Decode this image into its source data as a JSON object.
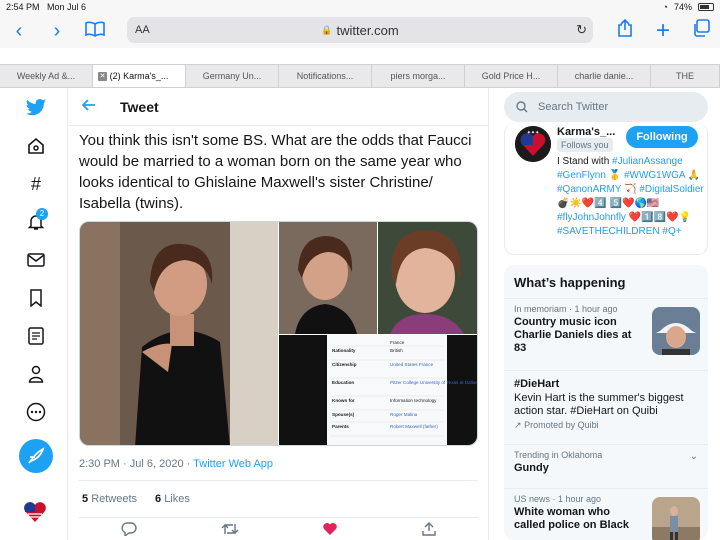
{
  "status": {
    "time": "2:54 PM",
    "date": "Mon Jul 6",
    "battery": "74%",
    "battery_level": 0.74
  },
  "browser": {
    "aa": "AA",
    "url": "twitter.com"
  },
  "tabs": [
    "Weekly Ad &...",
    "(2) Karma's_...",
    "Germany Un...",
    "Notifications...",
    "piers morga...",
    "Gold Price H...",
    "charlie danie...",
    "THE"
  ],
  "sidebar": {
    "notif_badge": "2"
  },
  "tweet": {
    "header": "Tweet",
    "text": "You think this isn't some BS. What are the odds that Faucci would be married to a woman born on the same year who looks identical to Ghislaine Maxwell's sister Christine/ Isabella (twins).",
    "time": "2:30 PM · Jul 6, 2020 · ",
    "source": "Twitter Web App",
    "retweets": "5",
    "retweets_label": "Retweets",
    "likes": "6",
    "likes_label": "Likes",
    "infobox": [
      [
        "",
        "France"
      ],
      [
        "Nationality",
        "British"
      ],
      [
        "Citizenship",
        "United States France"
      ],
      [
        "Education",
        "Pitzer College University of Texas at Dallas"
      ],
      [
        "Known for",
        "Information technology"
      ],
      [
        "Spouse(s)",
        "Roger Malina"
      ],
      [
        "Parents",
        "Robert Maxwell (father)"
      ]
    ]
  },
  "search": {
    "placeholder": "Search Twitter"
  },
  "profile": {
    "name": "Karma's_...",
    "follows": "Follows you",
    "button": "Following",
    "bio_1": "I Stand with ",
    "bio_tag_1": "#JulianAssange",
    "bio_tag_2": "#GenFlynn",
    "bio_tag_3": "#WWG1WGA",
    "bio_tag_4": "#QanonARMY",
    "bio_tag_5": "#DigitalSoldier",
    "bio_tag_6": "#flyJohnJohnfly",
    "bio_tag_7": "#SAVETHECHILDREN",
    "bio_tag_8": "#Q+"
  },
  "happening": {
    "header": "What’s happening",
    "trends": [
      {
        "meta": "In memoriam · 1 hour ago",
        "title": "Country music icon Charlie Daniels dies at 83"
      },
      {
        "title": "#DieHart",
        "desc": "Kevin Hart is the summer's biggest action star. #DieHart on Quibi",
        "promo": "Promoted by Quibi"
      },
      {
        "meta": "Trending in Oklahoma",
        "title": "Gundy"
      },
      {
        "meta": "US news · 1 hour ago",
        "title": "White woman who called police on Black"
      }
    ]
  },
  "colors": {
    "accent": "#1da1f2",
    "like": "#e0245e"
  }
}
